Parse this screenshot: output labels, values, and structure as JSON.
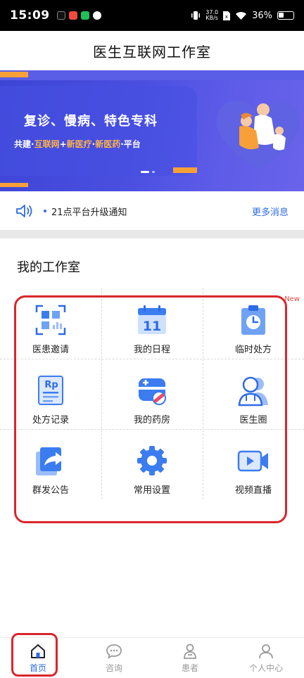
{
  "status_bar": {
    "time": "15:09",
    "net_speed_value": "37.0",
    "net_speed_unit": "KB/s",
    "battery": "36%",
    "battery_level": 0.36
  },
  "header": {
    "title": "医生互联网工作室"
  },
  "banner": {
    "title": "复诊、慢病、特色专科",
    "subtitle_parts": [
      "共建·",
      "互联网",
      "+",
      "新医疗",
      "·",
      "新医药",
      "·平台"
    ]
  },
  "notice": {
    "text": "21点平台升级通知",
    "more_label": "更多消息"
  },
  "workspace": {
    "title": "我的工作室",
    "new_badge": "New",
    "items": [
      {
        "label": "医患邀请",
        "icon": "qr-invite-icon"
      },
      {
        "label": "我的日程",
        "icon": "calendar-icon",
        "calendar_day": "11"
      },
      {
        "label": "临时处方",
        "icon": "clipboard-clock-icon"
      },
      {
        "label": "处方记录",
        "icon": "rx-document-icon"
      },
      {
        "label": "我的药房",
        "icon": "pharmacy-icon"
      },
      {
        "label": "医生圈",
        "icon": "doctor-circle-icon"
      },
      {
        "label": "群发公告",
        "icon": "share-announce-icon"
      },
      {
        "label": "常用设置",
        "icon": "gear-icon"
      },
      {
        "label": "视频直播",
        "icon": "video-camera-icon"
      }
    ]
  },
  "bottom_nav": {
    "items": [
      {
        "label": "首页",
        "icon": "home-icon",
        "active": true
      },
      {
        "label": "咨询",
        "icon": "chat-icon",
        "active": false
      },
      {
        "label": "患者",
        "icon": "patient-icon",
        "active": false
      },
      {
        "label": "个人中心",
        "icon": "profile-icon",
        "active": false
      }
    ]
  },
  "colors": {
    "accent": "#2e6be6",
    "banner": "#4a4fe0",
    "highlight": "#d9262c",
    "banner_highlight_text": "#ffb24a"
  }
}
